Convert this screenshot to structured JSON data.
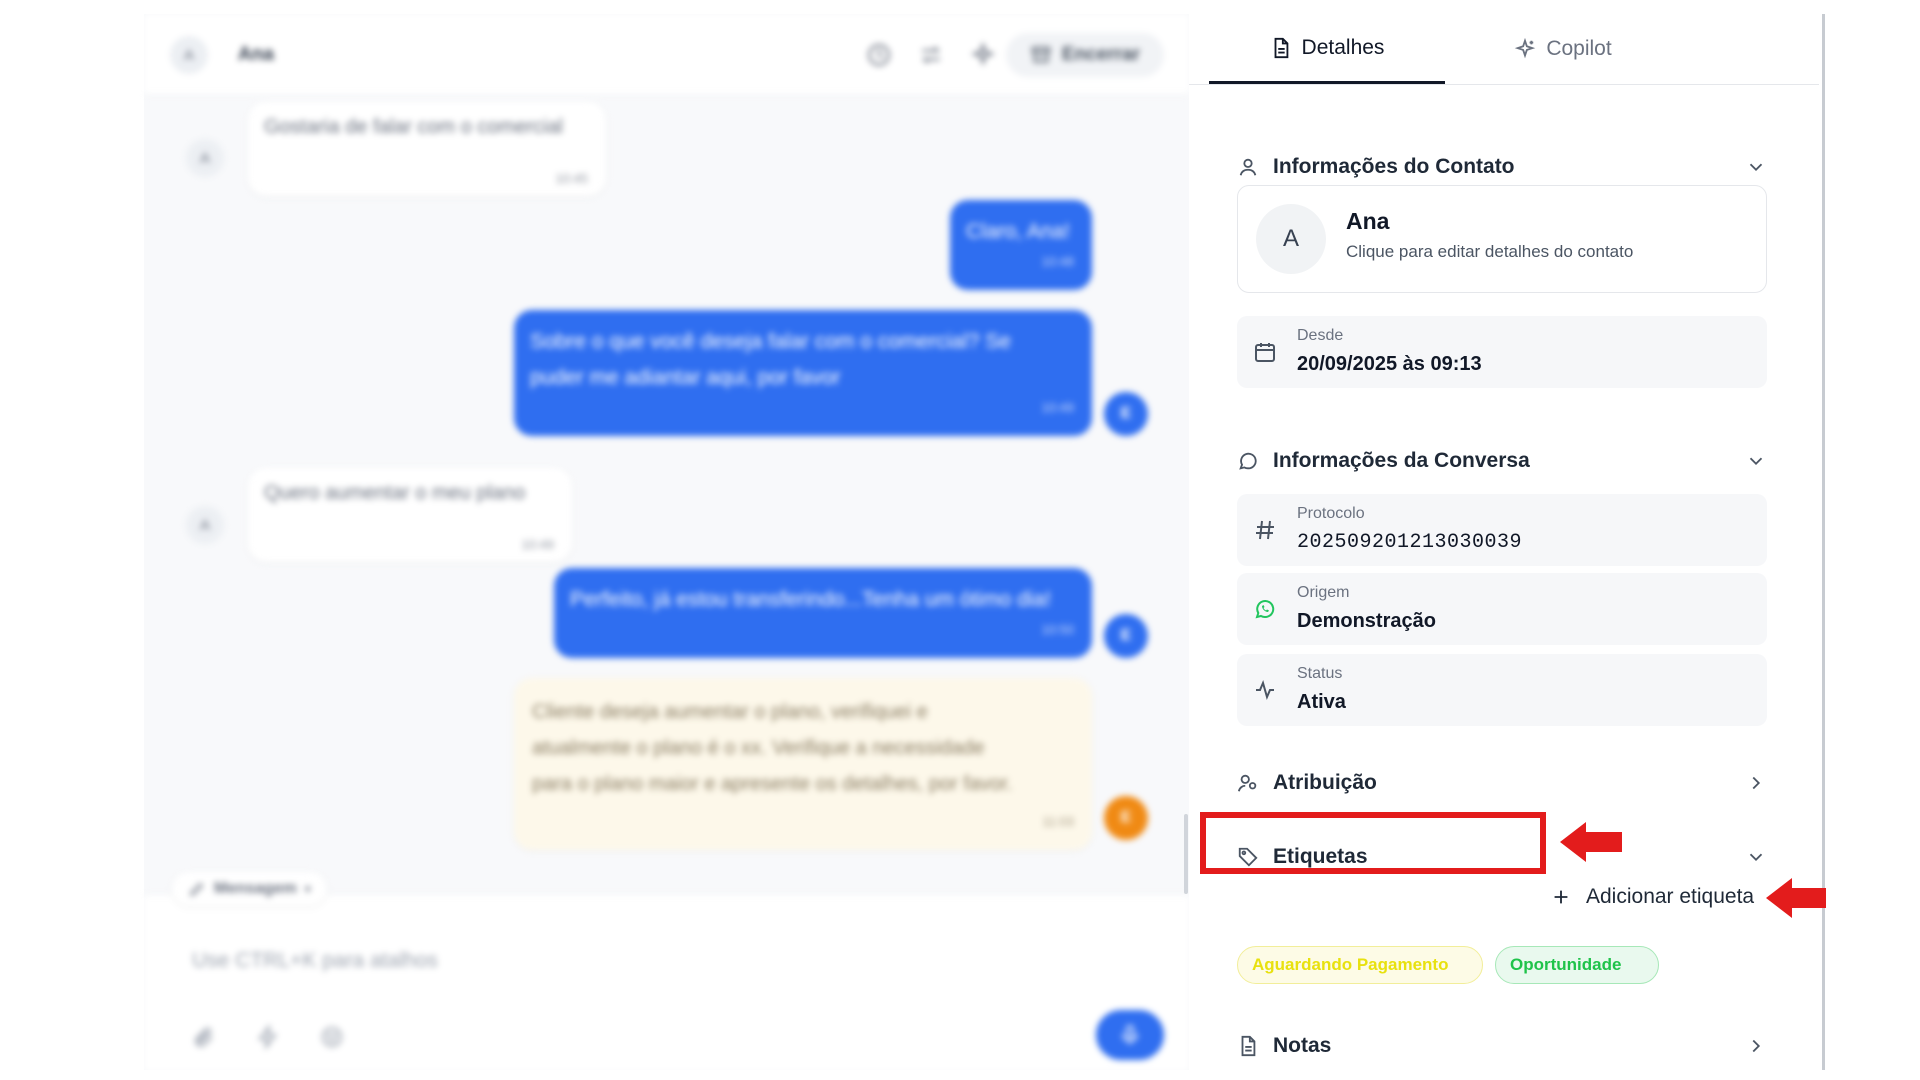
{
  "chat": {
    "contact_initial": "A",
    "contact_name": "Ana",
    "header_actions": [
      "clock-icon",
      "transfer-icon",
      "sparkle-icon"
    ],
    "end_label": "Encerrar",
    "messages": [
      {
        "from": "contact",
        "text": "Gostaria de falar com o comercial",
        "time": "10:45"
      },
      {
        "from": "agent",
        "text": "Claro, Ana!",
        "time": "10:48"
      },
      {
        "from": "agent",
        "text_line1": "Sobre o que você deseja falar com o comercial? Se",
        "text_line2": "puder me adiantar aqui, por favor",
        "time": "10:49",
        "agent_initial": "E"
      },
      {
        "from": "contact",
        "text": "Quero aumentar o meu plano",
        "time": "10:49"
      },
      {
        "from": "agent",
        "text": "Perfeito, já estou transferindo...Tenha um ótimo dia!",
        "time": "10:50",
        "agent_initial": "E"
      },
      {
        "from": "note",
        "text_line1": "Cliente deseja aumentar o plano, verifiquei e",
        "text_line2": "atualmente o plano é o xx. Verifique a necessidade",
        "text_line3": "para o plano maior e apresente os detalhes, por favor.",
        "time": "11:03",
        "agent_initial": "E"
      }
    ],
    "composer_mode": "Mensagem",
    "composer_placeholder": "Use CTRL+K para atalhos"
  },
  "details": {
    "tabs": [
      {
        "label": "Detalhes",
        "active": true
      },
      {
        "label": "Copilot",
        "active": false
      }
    ],
    "contact_section": {
      "title": "Informações do Contato",
      "initial": "A",
      "name": "Ana",
      "hint": "Clique para editar detalhes do contato",
      "since_label": "Desde",
      "since_value": "20/09/2025 às 09:13"
    },
    "conversation_section": {
      "title": "Informações da Conversa",
      "protocol_label": "Protocolo",
      "protocol_value": "202509201213030039",
      "origin_label": "Origem",
      "origin_value": "Demonstração",
      "status_label": "Status",
      "status_value": "Ativa"
    },
    "assignment_title": "Atribuição",
    "tags_title": "Etiquetas",
    "add_tag_label": "Adicionar etiqueta",
    "tags": [
      {
        "label": "Aguardando Pagamento",
        "color": "#e8e10f",
        "bg": "#fdfbe6",
        "border": "#f2ee9a"
      },
      {
        "label": "Oportunidade",
        "color": "#1fc34a",
        "bg": "#e9f9ee",
        "border": "#a7e8b8"
      }
    ],
    "notes_title": "Notas"
  },
  "annotation_color": "#e31c1c"
}
